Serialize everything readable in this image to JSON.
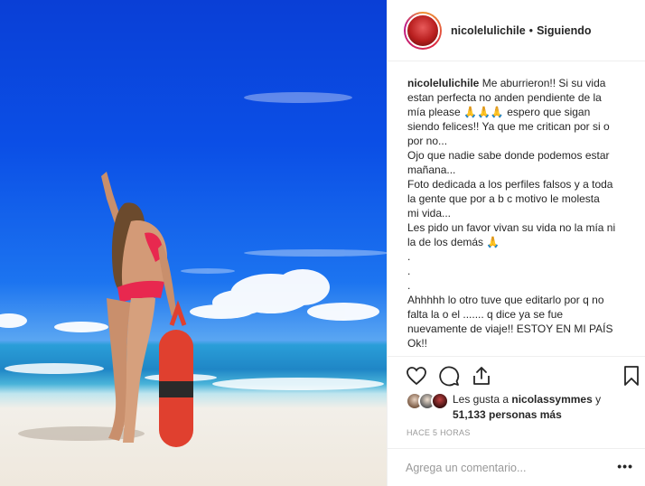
{
  "post": {
    "username": "nicolelulichile",
    "separator": "•",
    "follow_status": "Siguiendo",
    "caption_user": "nicolelulichile",
    "caption_lines": [
      "Me aburrieron!! Si su vida",
      "estan perfecta no anden pendiente de la",
      "mía please 🙏🙏🙏 espero que sigan",
      "siendo felices!! Ya que me critican por si o",
      "por no...",
      "Ojo que nadie sabe donde podemos estar",
      "mañana...",
      "Foto dedicada a los perfiles falsos y a toda",
      "la gente que por a b c motivo le molesta",
      "mi vida...",
      "Les pido un favor vivan su vida no la mía ni",
      "la de los demás 🙏",
      ".",
      ".",
      ".",
      "Ahhhhh lo otro tuve que editarlo por q no",
      "falta la o el ....... q dice ya se fue",
      "nuevamente de viaje!! ESTOY EN MI PAÍS",
      "Ok!!"
    ],
    "likes_prefix": "Les gusta a",
    "likes_user": "nicolassymmes",
    "likes_joiner": "y",
    "likes_count": "51,133 personas más",
    "timestamp": "HACE 5 HORAS",
    "comment_placeholder": "Agrega un comentario...",
    "more_label": "•••"
  },
  "icons": {
    "like": "heart-icon",
    "comment": "comment-bubble-icon",
    "share": "share-icon",
    "save": "bookmark-icon"
  }
}
